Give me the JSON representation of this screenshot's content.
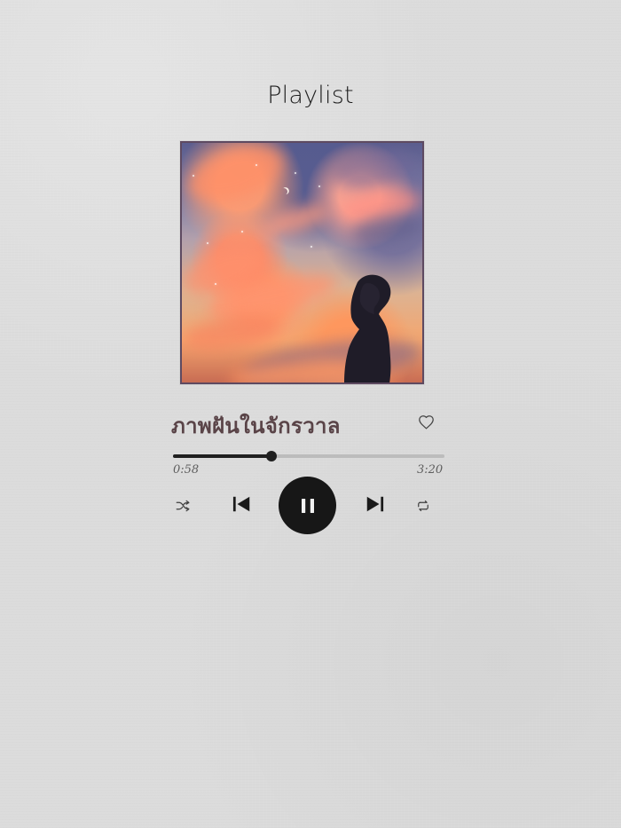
{
  "header": {
    "title": "Playlist"
  },
  "track": {
    "title": "ภาพฝันในจักรวาล",
    "current_time": "0:58",
    "total_time": "3:20",
    "progress": 0.3625
  },
  "icons": {
    "favorite": "heart-icon",
    "shuffle": "shuffle-icon",
    "previous": "skip-previous-icon",
    "play_pause": "pause-icon",
    "next": "skip-next-icon",
    "repeat": "repeat-icon"
  },
  "colors": {
    "background": "#dcdcdc",
    "title": "#1f1f1f",
    "song_title": "#5a4448",
    "accent_dark": "#171717",
    "progress_track": "#bcbcbc"
  }
}
